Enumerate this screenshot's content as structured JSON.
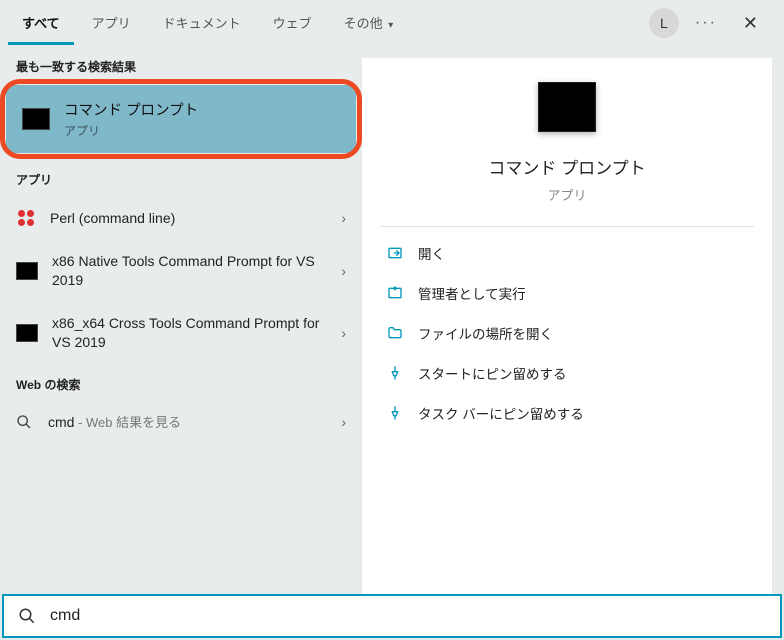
{
  "topbar": {
    "tabs": [
      {
        "label": "すべて",
        "active": true
      },
      {
        "label": "アプリ",
        "active": false
      },
      {
        "label": "ドキュメント",
        "active": false
      },
      {
        "label": "ウェブ",
        "active": false
      },
      {
        "label": "その他",
        "active": false,
        "dropdown": true
      }
    ],
    "avatar_letter": "L"
  },
  "left": {
    "best_match_header": "最も一致する検索結果",
    "best_match": {
      "title": "コマンド プロンプト",
      "subtitle": "アプリ"
    },
    "apps_header": "アプリ",
    "apps": [
      {
        "title": "Perl (command line)",
        "icon": "perl"
      },
      {
        "title": "x86 Native Tools Command Prompt for VS 2019",
        "icon": "terminal"
      },
      {
        "title": "x86_x64 Cross Tools Command Prompt for VS 2019",
        "icon": "terminal"
      }
    ],
    "web_header": "Web の検索",
    "web": {
      "query": "cmd",
      "suffix": " - Web 結果を見る"
    }
  },
  "right": {
    "title": "コマンド プロンプト",
    "subtitle": "アプリ",
    "actions": [
      {
        "label": "開く",
        "icon": "open"
      },
      {
        "label": "管理者として実行",
        "icon": "admin"
      },
      {
        "label": "ファイルの場所を開く",
        "icon": "folder"
      },
      {
        "label": "スタートにピン留めする",
        "icon": "pin"
      },
      {
        "label": "タスク バーにピン留めする",
        "icon": "pin"
      }
    ]
  },
  "search": {
    "value": "cmd"
  }
}
